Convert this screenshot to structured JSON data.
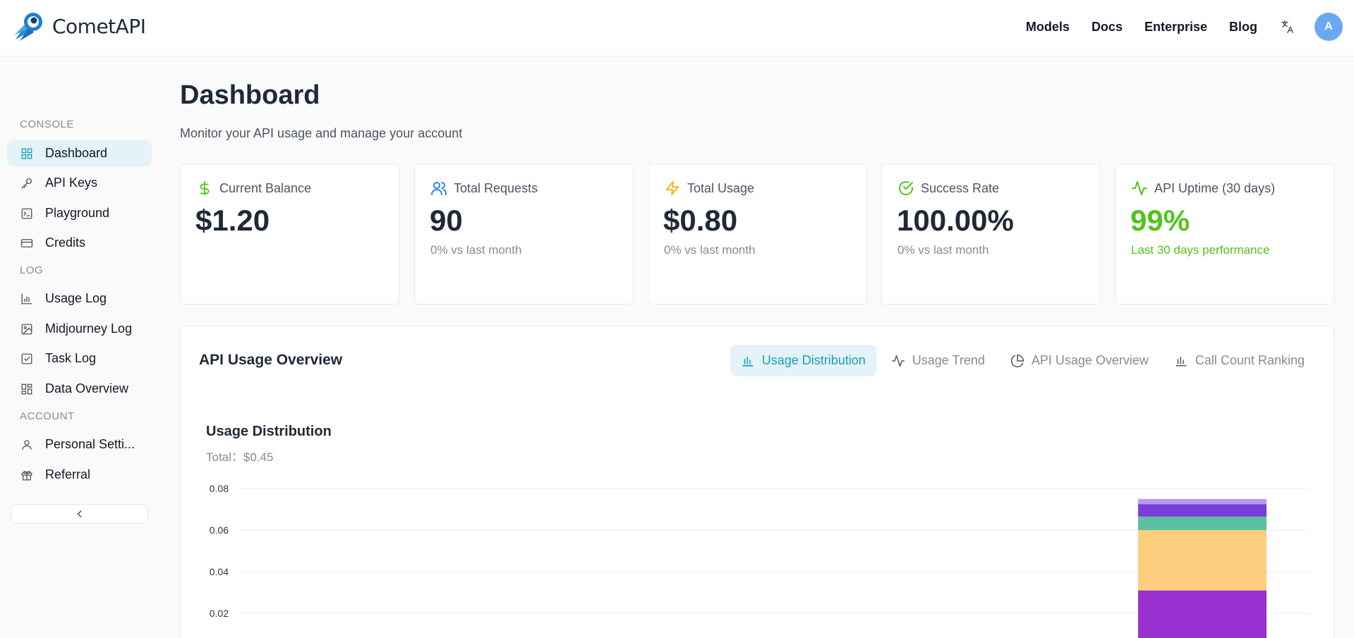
{
  "app": {
    "name": "CometAPI"
  },
  "nav": {
    "models": "Models",
    "docs": "Docs",
    "enterprise": "Enterprise",
    "blog": "Blog",
    "avatar_initial": "A"
  },
  "sidebar": {
    "sections": {
      "console": "CONSOLE",
      "log": "LOG",
      "account": "ACCOUNT"
    },
    "items": [
      {
        "label": "Dashboard",
        "icon": "grid-icon"
      },
      {
        "label": "API Keys",
        "icon": "key-icon"
      },
      {
        "label": "Playground",
        "icon": "terminal-icon"
      },
      {
        "label": "Credits",
        "icon": "credit-card-icon"
      },
      {
        "label": "Usage Log",
        "icon": "bar-chart-icon"
      },
      {
        "label": "Midjourney Log",
        "icon": "image-icon"
      },
      {
        "label": "Task Log",
        "icon": "checkbox-icon"
      },
      {
        "label": "Data Overview",
        "icon": "layout-icon"
      },
      {
        "label": "Personal Setti...",
        "icon": "user-icon"
      },
      {
        "label": "Referral",
        "icon": "gift-icon"
      }
    ]
  },
  "page": {
    "title": "Dashboard",
    "subtitle": "Monitor your API usage and manage your account"
  },
  "cards": [
    {
      "label": "Current Balance",
      "value": "$1.20",
      "note": "",
      "icon": "dollar-icon",
      "color": "#52c41a"
    },
    {
      "label": "Total Requests",
      "value": "90",
      "note": "0% vs last month",
      "icon": "users-icon",
      "color": "#1677ff"
    },
    {
      "label": "Total Usage",
      "value": "$0.80",
      "note": "0% vs last month",
      "icon": "lightning-icon",
      "color": "#faad14"
    },
    {
      "label": "Success Rate",
      "value": "100.00%",
      "note": "0% vs last month",
      "icon": "check-circle-icon",
      "color": "#52c41a"
    },
    {
      "label": "API Uptime (30 days)",
      "value": "99%",
      "note": "Last 30 days performance",
      "icon": "activity-icon",
      "color": "#52c41a"
    }
  ],
  "panel": {
    "title": "API Usage Overview",
    "tabs": [
      {
        "label": "Usage Distribution",
        "icon": "bar-chart-icon",
        "active": true
      },
      {
        "label": "Usage Trend",
        "icon": "activity-icon",
        "active": false
      },
      {
        "label": "API Usage Overview",
        "icon": "pie-chart-icon",
        "active": false
      },
      {
        "label": "Call Count Ranking",
        "icon": "bar-chart-icon",
        "active": false
      }
    ]
  },
  "chart_data": {
    "type": "bar",
    "stacked": true,
    "title": "Usage Distribution",
    "subtitle": "Total：$0.45",
    "y_ticks": [
      "0.08",
      "0.06",
      "0.04",
      "0.02"
    ],
    "ylim": [
      0,
      0.08
    ],
    "grid": true,
    "series": [
      {
        "values": [
          0.031
        ],
        "color": "#9b30d0"
      },
      {
        "values": [
          0.029
        ],
        "color": "#fdce7d"
      },
      {
        "values": [
          0.0065
        ],
        "color": "#5cc1a1"
      },
      {
        "values": [
          0.006
        ],
        "color": "#7b3dd8"
      },
      {
        "values": [
          0.0025
        ],
        "color": "#b89af0"
      }
    ]
  }
}
